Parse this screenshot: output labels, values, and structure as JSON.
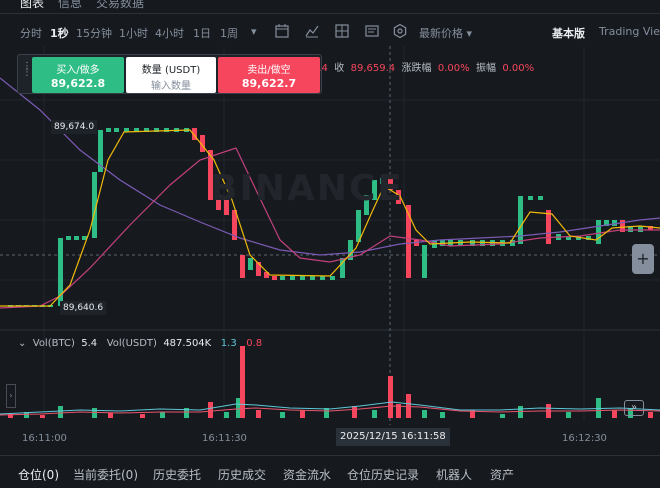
{
  "top_tabs": [
    {
      "label": "图表",
      "active": true
    },
    {
      "label": "信息",
      "active": false
    },
    {
      "label": "交易数据",
      "active": false
    }
  ],
  "toolbar": {
    "intervals": [
      "分时",
      "1秒",
      "15分钟",
      "1小时",
      "4小时",
      "1日",
      "1周"
    ],
    "active_interval": "1秒",
    "price_type": "最新价格",
    "basic_label": "基本版",
    "tradingview_label": "Trading View"
  },
  "trade_panel": {
    "buy_label": "买入/做多",
    "buy_price": "89,622.8",
    "qty_label": "数量 (USDT)",
    "qty_placeholder": "输入数量",
    "sell_label": "卖出/做空",
    "sell_price": "89,622.7"
  },
  "ohlc": {
    "open_tail": "9.4",
    "close_label": "收",
    "close_value": "89,659.4",
    "change_label": "涨跌幅",
    "change_value": "0.00%",
    "amp_label": "振幅",
    "amp_value": "0.00%"
  },
  "price_labels": {
    "high": "89,674.0",
    "low": "89,640.6"
  },
  "volume_legend": {
    "vol_btc_label": "Vol(BTC)",
    "vol_btc_value": "5.4",
    "vol_usdt_label": "Vol(USDT)",
    "vol_usdt_value": "487.504K",
    "ma1": "1.3",
    "ma2": "0.8"
  },
  "time_axis": [
    "16:11:00",
    "16:11:30",
    "16:12:30"
  ],
  "cursor_time": "2025/12/15 16:11:58",
  "watermark": "BINANCE",
  "bottom_tabs": [
    {
      "label": "仓位(0)",
      "active": true
    },
    {
      "label": "当前委托(0)",
      "active": false
    },
    {
      "label": "历史委托",
      "active": false
    },
    {
      "label": "历史成交",
      "active": false
    },
    {
      "label": "资金流水",
      "active": false
    },
    {
      "label": "仓位历史记录",
      "active": false
    },
    {
      "label": "机器人",
      "active": false
    },
    {
      "label": "资产",
      "active": false
    }
  ],
  "colors": {
    "up": "#2ebd85",
    "down": "#f6465d",
    "ma_fast": "#f0b90b",
    "ma_mid": "#c2407d",
    "ma_slow": "#7b5bb4",
    "vol_line": "#5fc7d8"
  }
}
